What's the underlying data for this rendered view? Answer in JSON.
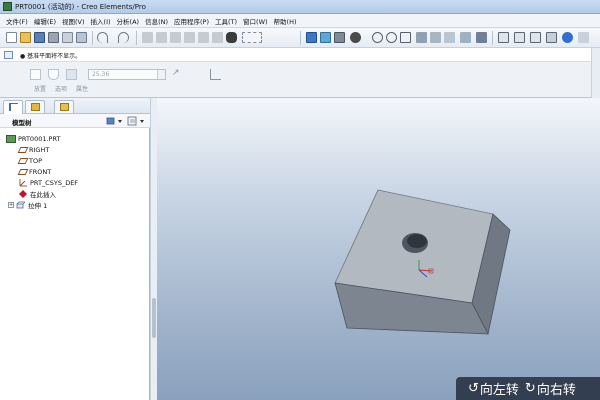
{
  "window": {
    "title": "PRT0001 (活动的) - Creo Elements/Pro"
  },
  "menubar": {
    "items": [
      "文件(F)",
      "编辑(E)",
      "视图(V)",
      "插入(I)",
      "分析(A)",
      "信息(N)",
      "应用程序(P)",
      "工具(T)",
      "窗口(W)",
      "帮助(H)"
    ]
  },
  "dashboard": {
    "message": "● 基准平面将不显示。",
    "depth_value": "25.36",
    "tabs": [
      "放置",
      "选项",
      "属性"
    ]
  },
  "model_tree": {
    "title": "模型树",
    "items": [
      {
        "label": "PRT0001.PRT",
        "icon": "part-icon"
      },
      {
        "label": "RIGHT",
        "icon": "datum-plane-icon"
      },
      {
        "label": "TOP",
        "icon": "datum-plane-icon"
      },
      {
        "label": "FRONT",
        "icon": "datum-plane-icon"
      },
      {
        "label": "PRT_CSYS_DEF",
        "icon": "csys-icon"
      },
      {
        "label": "在此插入",
        "icon": "insert-here-icon"
      },
      {
        "label": "拉伸 1",
        "icon": "extrude-icon"
      }
    ]
  },
  "overlay": {
    "rotate_left": "向左转",
    "rotate_right": "向右转"
  },
  "colors": {
    "title_bar": "#b3cbe8",
    "viewport_top": "#f3f6fa",
    "viewport_bottom": "#8aa1bd",
    "model_face": "#aeb6bf",
    "insert_marker": "#c8102e",
    "overlay_bg": "#192332"
  }
}
